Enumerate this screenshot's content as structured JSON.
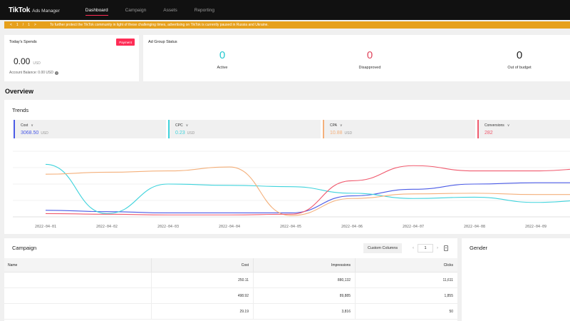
{
  "app": {
    "logo": "TikTok",
    "logo_sub": "Ads Manager"
  },
  "nav": [
    {
      "label": "Dashboard",
      "active": true
    },
    {
      "label": "Campaign",
      "active": false
    },
    {
      "label": "Assets",
      "active": false
    },
    {
      "label": "Reporting",
      "active": false
    }
  ],
  "banner": {
    "prev": "<",
    "page": "1",
    "sep": "/",
    "total": "1",
    "next": ">",
    "text": "To further protect the TikTok community in light of these challenging times, advertising on TikTok is currently paused in Russia and Ukraine."
  },
  "spend": {
    "title": "Today's Spends",
    "button": "Payment",
    "value": "0.00",
    "unit": "USD",
    "balance": "Account Balance: 0.00 USD"
  },
  "status": {
    "title": "Ad Group Status",
    "items": [
      {
        "value": "0",
        "label": "Active",
        "color": "#25c9d0"
      },
      {
        "value": "0",
        "label": "Disapproved",
        "color": "#e0475f"
      },
      {
        "value": "0",
        "label": "Out of budget",
        "color": "#222222"
      }
    ]
  },
  "overview": {
    "title": "Overview"
  },
  "trends": {
    "title": "Trends",
    "metrics": [
      {
        "name": "Cost",
        "value": "3068.50",
        "unit": "USD",
        "color": "#4b5be6"
      },
      {
        "name": "CPC",
        "value": "0.23",
        "unit": "USD",
        "color": "#3fd3dc"
      },
      {
        "name": "CPA",
        "value": "10.88",
        "unit": "USD",
        "color": "#f4b07b"
      },
      {
        "name": "Conversions",
        "value": "282",
        "unit": "",
        "color": "#f05a6e"
      }
    ],
    "dates": [
      "2022-04-01",
      "2022-04-02",
      "2022-04-03",
      "2022-04-04",
      "2022-04-05",
      "2022-04-06",
      "2022-04-07",
      "2022-04-08",
      "2022-04-09"
    ]
  },
  "chart_data": {
    "type": "line",
    "x": [
      "2022-04-01",
      "2022-04-02",
      "2022-04-03",
      "2022-04-04",
      "2022-04-05",
      "2022-04-06",
      "2022-04-07",
      "2022-04-08",
      "2022-04-09",
      "2022-04-10"
    ],
    "series": [
      {
        "name": "Cost",
        "color": "#4b5be6",
        "values": [
          0.1,
          0.08,
          0.06,
          0.06,
          0.06,
          0.32,
          0.42,
          0.5,
          0.52,
          0.52
        ]
      },
      {
        "name": "CPC",
        "color": "#3fd3dc",
        "values": [
          0.8,
          0.05,
          0.5,
          0.48,
          0.46,
          0.36,
          0.28,
          0.3,
          0.22,
          0.26
        ]
      },
      {
        "name": "CPA",
        "color": "#f4b07b",
        "values": [
          0.65,
          0.68,
          0.7,
          0.76,
          0.02,
          0.28,
          0.35,
          0.36,
          0.34,
          0.34
        ]
      },
      {
        "name": "Conversions",
        "color": "#f05a6e",
        "values": [
          0.05,
          0.04,
          0.03,
          0.03,
          0.04,
          0.55,
          0.78,
          0.7,
          0.7,
          0.74
        ]
      }
    ],
    "grid": true
  },
  "campaign": {
    "title": "Campaign",
    "custom_columns": "Custom Columns",
    "page": "1",
    "columns": [
      "Name",
      "Cost",
      "Impressions",
      "Clicks"
    ],
    "rows": [
      {
        "name": "",
        "cost": "250.11",
        "impressions": "880,132",
        "clicks": "11,611"
      },
      {
        "name": "",
        "cost": "498.92",
        "impressions": "89,885",
        "clicks": "1,855"
      },
      {
        "name": "",
        "cost": "29.19",
        "impressions": "3,816",
        "clicks": "50"
      }
    ]
  },
  "gender": {
    "title": "Gender"
  }
}
